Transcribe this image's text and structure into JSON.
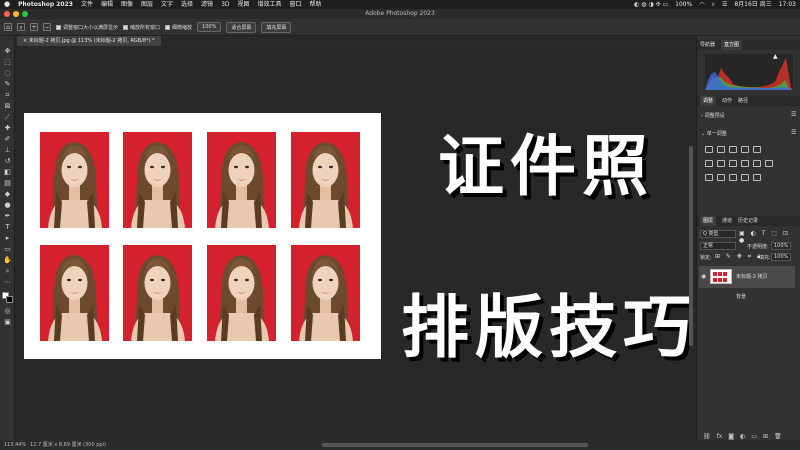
{
  "menubar": {
    "apple": "",
    "app": "Photoshop 2023",
    "items": [
      "文件",
      "编辑",
      "图像",
      "图层",
      "文字",
      "选择",
      "滤镜",
      "3D",
      "视图",
      "增效工具",
      "窗口",
      "帮助"
    ],
    "status": [
      "100%",
      "8月16日 周三",
      "17:03"
    ]
  },
  "window": {
    "title": "Adobe Photoshop 2023"
  },
  "options": {
    "zoom_in": "+",
    "zoom_out": "−",
    "resize_windows": "调整窗口大小以满屏显示",
    "zoom_all": "缩放所有窗口",
    "scrubby": "细微缩放",
    "pct_btn": "100%",
    "fit_btn": "适合屏幕",
    "fill_btn": "填充屏幕"
  },
  "document": {
    "tab": "未标题-2 拷贝.jpg @ 113% (未标题-2 拷贝, RGB/8*) *",
    "photo_rows": 2,
    "photo_cols": 4,
    "headline_1": "证件照",
    "headline_2": "排版技巧"
  },
  "status": {
    "zoom": "113.44%",
    "size": "12.7 厘米 x 8.89 厘米 (300 ppi)"
  },
  "panels": {
    "top_tabs": [
      "导航器",
      "直方图"
    ],
    "adjust_tabs": [
      "调整",
      "动作",
      "路径"
    ],
    "adjust_presets": "调整预设",
    "single_adjust": "单一调整",
    "layer_tabs": [
      "图层",
      "通道",
      "历史记录"
    ],
    "kind": "Q 类型",
    "blend": "正常",
    "opacity_label": "不透明度:",
    "opacity": "100%",
    "lock_label": "锁定:",
    "fill_label": "填充:",
    "fill": "100%",
    "layer_name": "未标题-2 拷贝",
    "bg_layer": "背景"
  },
  "colors": {
    "photo_bg": "#d5202e",
    "accent": "#2f6dc9"
  }
}
